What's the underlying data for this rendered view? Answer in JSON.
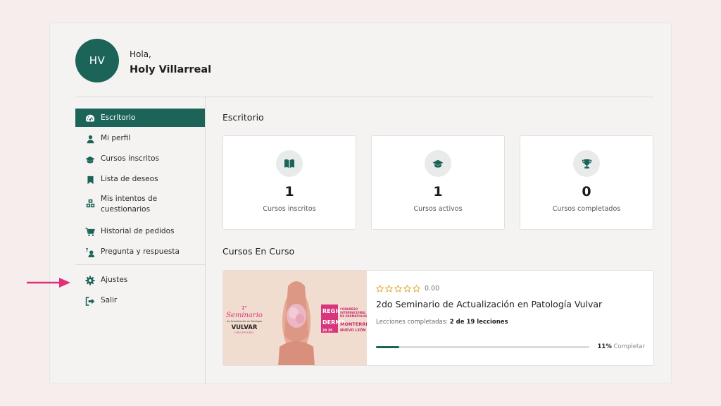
{
  "user": {
    "initials": "HV",
    "greeting": "Hola,",
    "name": "Holy Villarreal"
  },
  "sidebar": {
    "items": [
      {
        "label": "Escritorio",
        "icon": "dashboard-icon",
        "active": true
      },
      {
        "label": "Mi perfil",
        "icon": "user-icon"
      },
      {
        "label": "Cursos inscritos",
        "icon": "graduation-cap-icon"
      },
      {
        "label": "Lista de deseos",
        "icon": "bookmark-icon"
      },
      {
        "label": "Mis intentos de cuestionarios",
        "icon": "quiz-blocks-icon"
      },
      {
        "label": "Historial de pedidos",
        "icon": "cart-icon"
      },
      {
        "label": "Pregunta y respuesta",
        "icon": "question-answer-icon"
      }
    ],
    "bottom_items": [
      {
        "label": "Ajustes",
        "icon": "gear-icon"
      },
      {
        "label": "Salir",
        "icon": "sign-out-icon"
      }
    ]
  },
  "main": {
    "title": "Escritorio",
    "stats": [
      {
        "value": "1",
        "label": "Cursos inscritos",
        "icon": "book-icon"
      },
      {
        "value": "1",
        "label": "Cursos activos",
        "icon": "graduation-cap-icon"
      },
      {
        "value": "0",
        "label": "Cursos completados",
        "icon": "trophy-icon"
      }
    ],
    "in_progress_title": "Cursos En Curso",
    "course": {
      "rating": "0.00",
      "stars": 5,
      "title": "2do Seminario de Actualización en Patología Vulvar",
      "lessons_label": "Lecciones completadas:",
      "lessons_value": "2 de 19 lecciones",
      "progress": 0.11,
      "progress_pct": "11%",
      "progress_label": "Completar"
    }
  },
  "colors": {
    "accent": "#1c6458",
    "arrow": "#e0307a",
    "star": "#e0a526",
    "background": "#f6eeed"
  }
}
